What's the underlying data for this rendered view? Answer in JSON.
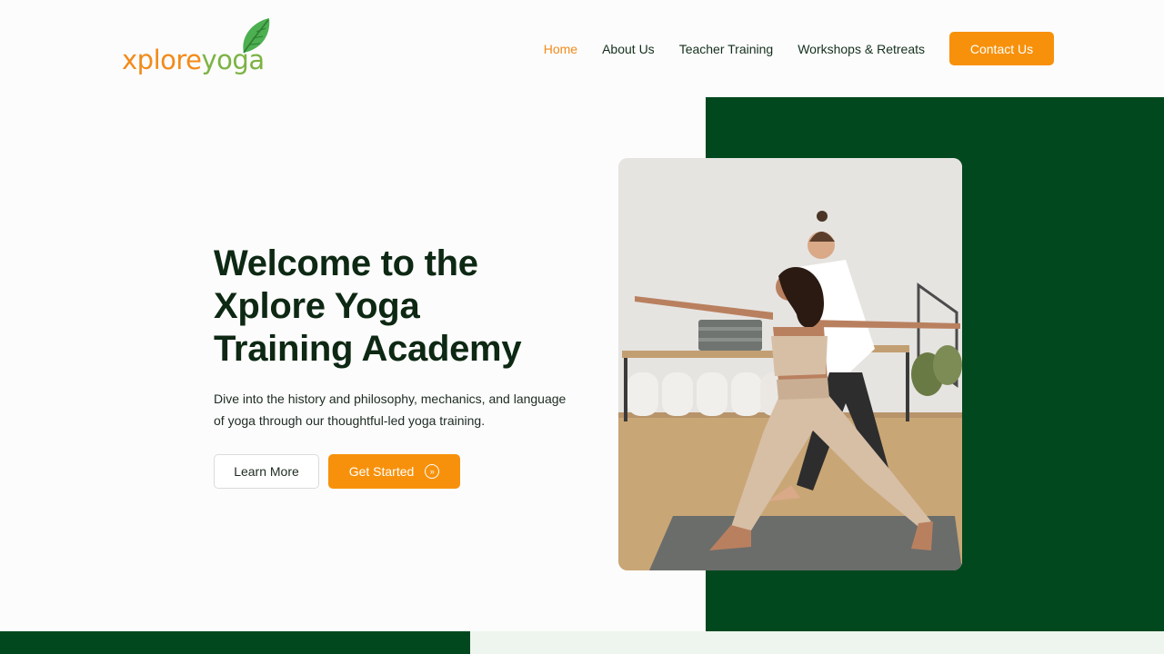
{
  "brand": {
    "logo_part1": "xplore",
    "logo_part2": "yoga",
    "accent_orange": "#f7910b",
    "brand_green": "#02481e"
  },
  "nav": {
    "items": [
      {
        "label": "Home",
        "active": true
      },
      {
        "label": "About Us",
        "active": false
      },
      {
        "label": "Teacher Training",
        "active": false
      },
      {
        "label": "Workshops & Retreats",
        "active": false
      }
    ],
    "cta_label": "Contact Us"
  },
  "hero": {
    "title_line1": "Welcome to the",
    "title_line2": "Xplore Yoga",
    "title_line3": "Training Academy",
    "description": "Dive into the history and philosophy, mechanics, and language of yoga through our thoughtful-led yoga training.",
    "learn_more_label": "Learn More",
    "get_started_label": "Get Started",
    "get_started_icon": "double-chevron-right-icon"
  },
  "image": {
    "subject": "yoga-instructor-assisting-warrior-pose-photo"
  }
}
